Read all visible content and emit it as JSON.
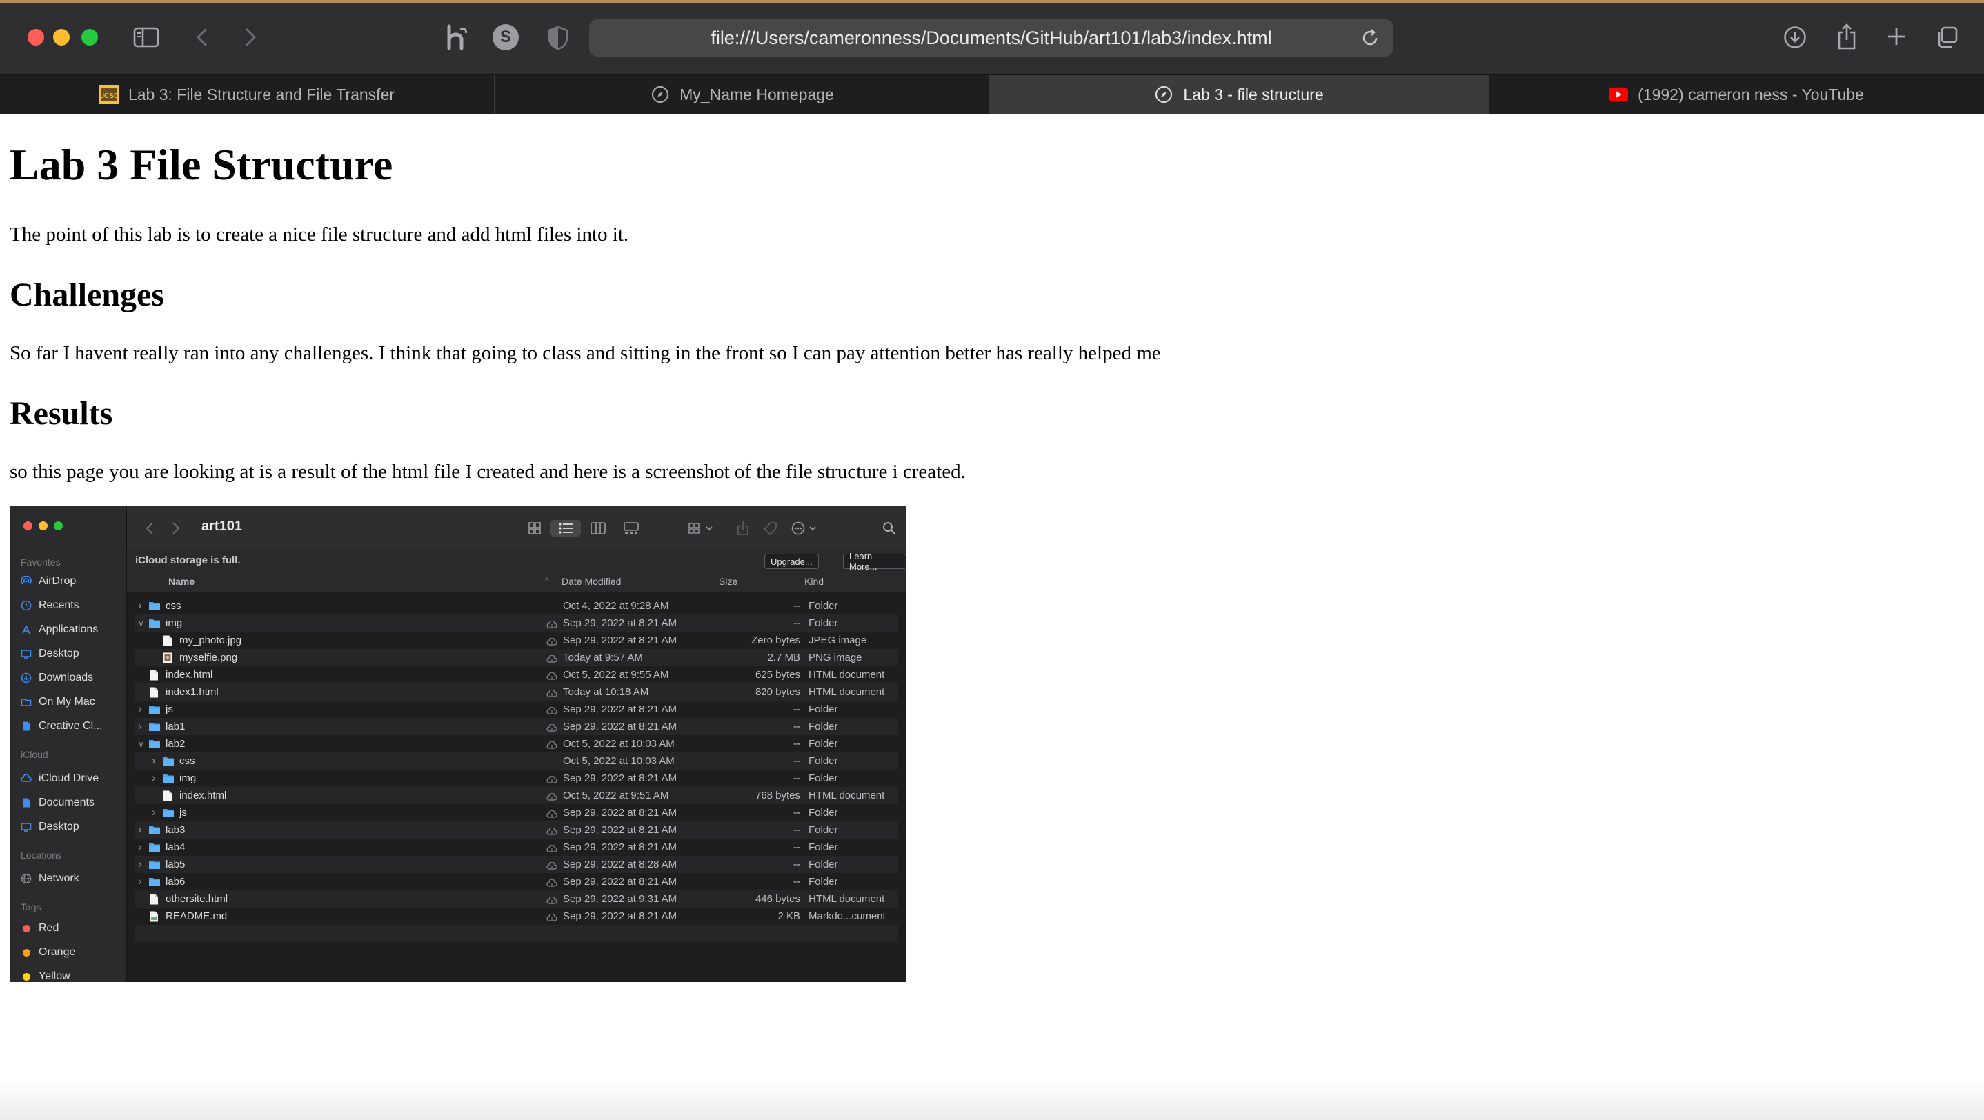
{
  "browser": {
    "url": "file:///Users/cameronness/Documents/GitHub/art101/lab3/index.html",
    "tabs": [
      {
        "label": "Lab 3: File Structure and File Transfer",
        "favicon": "ucsc-logo-icon",
        "active": false
      },
      {
        "label": "My_Name Homepage",
        "favicon": "compass-icon",
        "active": false
      },
      {
        "label": "Lab 3 - file structure",
        "favicon": "compass-icon",
        "active": true
      },
      {
        "label": "(1992) cameron ness - YouTube",
        "favicon": "youtube-icon",
        "active": false
      }
    ],
    "extension_s_label": "S"
  },
  "page": {
    "title": "Lab 3 File Structure",
    "intro": "The point of this lab is to create a nice file structure and add html files into it.",
    "challenges_heading": "Challenges",
    "challenges_text": "So far I havent really ran into any challenges. I think that going to class and sitting in the front so I can pay attention better has really helped me",
    "results_heading": "Results",
    "results_text": "so this page you are looking at is a result of the html file I created and here is a screenshot of the file structure i created."
  },
  "finder": {
    "folder_title": "art101",
    "banner_message": "iCloud storage is full.",
    "upgrade_label": "Upgrade...",
    "learn_more_label": "Learn More...",
    "columns": {
      "name": "Name",
      "date": "Date Modified",
      "size": "Size",
      "kind": "Kind"
    },
    "sidebar": {
      "favorites_heading": "Favorites",
      "favorites": [
        {
          "label": "AirDrop",
          "icon": "airdrop-icon"
        },
        {
          "label": "Recents",
          "icon": "clock-icon"
        },
        {
          "label": "Applications",
          "icon": "applications-icon"
        },
        {
          "label": "Desktop",
          "icon": "desktop-icon"
        },
        {
          "label": "Downloads",
          "icon": "download-icon"
        },
        {
          "label": "On My Mac",
          "icon": "folder-icon"
        },
        {
          "label": "Creative Cl...",
          "icon": "document-icon"
        }
      ],
      "icloud_heading": "iCloud",
      "icloud": [
        {
          "label": "iCloud Drive",
          "icon": "cloud-icon"
        },
        {
          "label": "Documents",
          "icon": "document-icon"
        },
        {
          "label": "Desktop",
          "icon": "desktop-icon"
        }
      ],
      "locations_heading": "Locations",
      "locations": [
        {
          "label": "Network",
          "icon": "network-icon"
        }
      ],
      "tags_heading": "Tags",
      "tags": [
        {
          "label": "Red",
          "color": "#ff5f57"
        },
        {
          "label": "Orange",
          "color": "#ff9f0a"
        },
        {
          "label": "Yellow",
          "color": "#ffd60a"
        }
      ]
    },
    "files": [
      {
        "name": "css",
        "type": "folder",
        "depth": 0,
        "disclosure": "closed",
        "cloud": false,
        "date": "Oct 4, 2022 at 9:28 AM",
        "size": "--",
        "kind": "Folder"
      },
      {
        "name": "img",
        "type": "folder",
        "depth": 0,
        "disclosure": "open",
        "cloud": true,
        "date": "Sep 29, 2022 at 8:21 AM",
        "size": "--",
        "kind": "Folder"
      },
      {
        "name": "my_photo.jpg",
        "type": "file",
        "depth": 1,
        "disclosure": "",
        "cloud": true,
        "date": "Sep 29, 2022 at 8:21 AM",
        "size": "Zero bytes",
        "kind": "JPEG image"
      },
      {
        "name": "myselfie.png",
        "type": "image",
        "depth": 1,
        "disclosure": "",
        "cloud": true,
        "date": "Today at 9:57 AM",
        "size": "2.7 MB",
        "kind": "PNG image"
      },
      {
        "name": "index.html",
        "type": "file",
        "depth": 0,
        "disclosure": "",
        "cloud": true,
        "date": "Oct 5, 2022 at 9:55 AM",
        "size": "625 bytes",
        "kind": "HTML document"
      },
      {
        "name": "index1.html",
        "type": "file",
        "depth": 0,
        "disclosure": "",
        "cloud": true,
        "date": "Today at 10:18 AM",
        "size": "820 bytes",
        "kind": "HTML document"
      },
      {
        "name": "js",
        "type": "folder",
        "depth": 0,
        "disclosure": "closed",
        "cloud": true,
        "date": "Sep 29, 2022 at 8:21 AM",
        "size": "--",
        "kind": "Folder"
      },
      {
        "name": "lab1",
        "type": "folder",
        "depth": 0,
        "disclosure": "closed",
        "cloud": true,
        "date": "Sep 29, 2022 at 8:21 AM",
        "size": "--",
        "kind": "Folder"
      },
      {
        "name": "lab2",
        "type": "folder",
        "depth": 0,
        "disclosure": "open",
        "cloud": true,
        "date": "Oct 5, 2022 at 10:03 AM",
        "size": "--",
        "kind": "Folder"
      },
      {
        "name": "css",
        "type": "folder",
        "depth": 1,
        "disclosure": "closed",
        "cloud": false,
        "date": "Oct 5, 2022 at 10:03 AM",
        "size": "--",
        "kind": "Folder"
      },
      {
        "name": "img",
        "type": "folder",
        "depth": 1,
        "disclosure": "closed",
        "cloud": true,
        "date": "Sep 29, 2022 at 8:21 AM",
        "size": "--",
        "kind": "Folder"
      },
      {
        "name": "index.html",
        "type": "file",
        "depth": 1,
        "disclosure": "",
        "cloud": true,
        "date": "Oct 5, 2022 at 9:51 AM",
        "size": "768 bytes",
        "kind": "HTML document"
      },
      {
        "name": "js",
        "type": "folder",
        "depth": 1,
        "disclosure": "closed",
        "cloud": true,
        "date": "Sep 29, 2022 at 8:21 AM",
        "size": "--",
        "kind": "Folder"
      },
      {
        "name": "lab3",
        "type": "folder",
        "depth": 0,
        "disclosure": "closed",
        "cloud": true,
        "date": "Sep 29, 2022 at 8:21 AM",
        "size": "--",
        "kind": "Folder"
      },
      {
        "name": "lab4",
        "type": "folder",
        "depth": 0,
        "disclosure": "closed",
        "cloud": true,
        "date": "Sep 29, 2022 at 8:21 AM",
        "size": "--",
        "kind": "Folder"
      },
      {
        "name": "lab5",
        "type": "folder",
        "depth": 0,
        "disclosure": "closed",
        "cloud": true,
        "date": "Sep 29, 2022 at 8:28 AM",
        "size": "--",
        "kind": "Folder"
      },
      {
        "name": "lab6",
        "type": "folder",
        "depth": 0,
        "disclosure": "closed",
        "cloud": true,
        "date": "Sep 29, 2022 at 8:21 AM",
        "size": "--",
        "kind": "Folder"
      },
      {
        "name": "othersite.html",
        "type": "file",
        "depth": 0,
        "disclosure": "",
        "cloud": true,
        "date": "Sep 29, 2022 at 9:31 AM",
        "size": "446 bytes",
        "kind": "HTML document"
      },
      {
        "name": "README.md",
        "type": "markdown",
        "depth": 0,
        "disclosure": "",
        "cloud": true,
        "date": "Sep 29, 2022 at 8:21 AM",
        "size": "2 KB",
        "kind": "Markdo...cument"
      }
    ]
  },
  "colors": {
    "traffic_red": "#ff5f57",
    "traffic_yellow": "#febc2e",
    "traffic_green": "#28c840",
    "folder_blue": "#4aa3f0",
    "youtube_red": "#ff0000",
    "ucsc_gold": "#f3c13a"
  }
}
